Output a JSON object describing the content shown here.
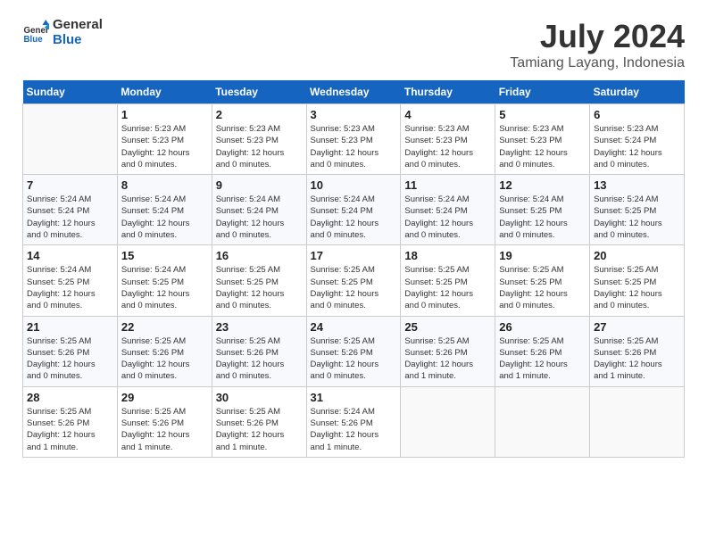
{
  "logo": {
    "text_general": "General",
    "text_blue": "Blue"
  },
  "title": "July 2024",
  "subtitle": "Tamiang Layang, Indonesia",
  "headers": [
    "Sunday",
    "Monday",
    "Tuesday",
    "Wednesday",
    "Thursday",
    "Friday",
    "Saturday"
  ],
  "weeks": [
    [
      {
        "day": "",
        "info": ""
      },
      {
        "day": "1",
        "info": "Sunrise: 5:23 AM\nSunset: 5:23 PM\nDaylight: 12 hours\nand 0 minutes."
      },
      {
        "day": "2",
        "info": "Sunrise: 5:23 AM\nSunset: 5:23 PM\nDaylight: 12 hours\nand 0 minutes."
      },
      {
        "day": "3",
        "info": "Sunrise: 5:23 AM\nSunset: 5:23 PM\nDaylight: 12 hours\nand 0 minutes."
      },
      {
        "day": "4",
        "info": "Sunrise: 5:23 AM\nSunset: 5:23 PM\nDaylight: 12 hours\nand 0 minutes."
      },
      {
        "day": "5",
        "info": "Sunrise: 5:23 AM\nSunset: 5:23 PM\nDaylight: 12 hours\nand 0 minutes."
      },
      {
        "day": "6",
        "info": "Sunrise: 5:23 AM\nSunset: 5:24 PM\nDaylight: 12 hours\nand 0 minutes."
      }
    ],
    [
      {
        "day": "7",
        "info": "Sunrise: 5:24 AM\nSunset: 5:24 PM\nDaylight: 12 hours\nand 0 minutes."
      },
      {
        "day": "8",
        "info": "Sunrise: 5:24 AM\nSunset: 5:24 PM\nDaylight: 12 hours\nand 0 minutes."
      },
      {
        "day": "9",
        "info": "Sunrise: 5:24 AM\nSunset: 5:24 PM\nDaylight: 12 hours\nand 0 minutes."
      },
      {
        "day": "10",
        "info": "Sunrise: 5:24 AM\nSunset: 5:24 PM\nDaylight: 12 hours\nand 0 minutes."
      },
      {
        "day": "11",
        "info": "Sunrise: 5:24 AM\nSunset: 5:24 PM\nDaylight: 12 hours\nand 0 minutes."
      },
      {
        "day": "12",
        "info": "Sunrise: 5:24 AM\nSunset: 5:25 PM\nDaylight: 12 hours\nand 0 minutes."
      },
      {
        "day": "13",
        "info": "Sunrise: 5:24 AM\nSunset: 5:25 PM\nDaylight: 12 hours\nand 0 minutes."
      }
    ],
    [
      {
        "day": "14",
        "info": "Sunrise: 5:24 AM\nSunset: 5:25 PM\nDaylight: 12 hours\nand 0 minutes."
      },
      {
        "day": "15",
        "info": "Sunrise: 5:24 AM\nSunset: 5:25 PM\nDaylight: 12 hours\nand 0 minutes."
      },
      {
        "day": "16",
        "info": "Sunrise: 5:25 AM\nSunset: 5:25 PM\nDaylight: 12 hours\nand 0 minutes."
      },
      {
        "day": "17",
        "info": "Sunrise: 5:25 AM\nSunset: 5:25 PM\nDaylight: 12 hours\nand 0 minutes."
      },
      {
        "day": "18",
        "info": "Sunrise: 5:25 AM\nSunset: 5:25 PM\nDaylight: 12 hours\nand 0 minutes."
      },
      {
        "day": "19",
        "info": "Sunrise: 5:25 AM\nSunset: 5:25 PM\nDaylight: 12 hours\nand 0 minutes."
      },
      {
        "day": "20",
        "info": "Sunrise: 5:25 AM\nSunset: 5:25 PM\nDaylight: 12 hours\nand 0 minutes."
      }
    ],
    [
      {
        "day": "21",
        "info": "Sunrise: 5:25 AM\nSunset: 5:26 PM\nDaylight: 12 hours\nand 0 minutes."
      },
      {
        "day": "22",
        "info": "Sunrise: 5:25 AM\nSunset: 5:26 PM\nDaylight: 12 hours\nand 0 minutes."
      },
      {
        "day": "23",
        "info": "Sunrise: 5:25 AM\nSunset: 5:26 PM\nDaylight: 12 hours\nand 0 minutes."
      },
      {
        "day": "24",
        "info": "Sunrise: 5:25 AM\nSunset: 5:26 PM\nDaylight: 12 hours\nand 0 minutes."
      },
      {
        "day": "25",
        "info": "Sunrise: 5:25 AM\nSunset: 5:26 PM\nDaylight: 12 hours\nand 1 minute."
      },
      {
        "day": "26",
        "info": "Sunrise: 5:25 AM\nSunset: 5:26 PM\nDaylight: 12 hours\nand 1 minute."
      },
      {
        "day": "27",
        "info": "Sunrise: 5:25 AM\nSunset: 5:26 PM\nDaylight: 12 hours\nand 1 minute."
      }
    ],
    [
      {
        "day": "28",
        "info": "Sunrise: 5:25 AM\nSunset: 5:26 PM\nDaylight: 12 hours\nand 1 minute."
      },
      {
        "day": "29",
        "info": "Sunrise: 5:25 AM\nSunset: 5:26 PM\nDaylight: 12 hours\nand 1 minute."
      },
      {
        "day": "30",
        "info": "Sunrise: 5:25 AM\nSunset: 5:26 PM\nDaylight: 12 hours\nand 1 minute."
      },
      {
        "day": "31",
        "info": "Sunrise: 5:24 AM\nSunset: 5:26 PM\nDaylight: 12 hours\nand 1 minute."
      },
      {
        "day": "",
        "info": ""
      },
      {
        "day": "",
        "info": ""
      },
      {
        "day": "",
        "info": ""
      }
    ]
  ]
}
